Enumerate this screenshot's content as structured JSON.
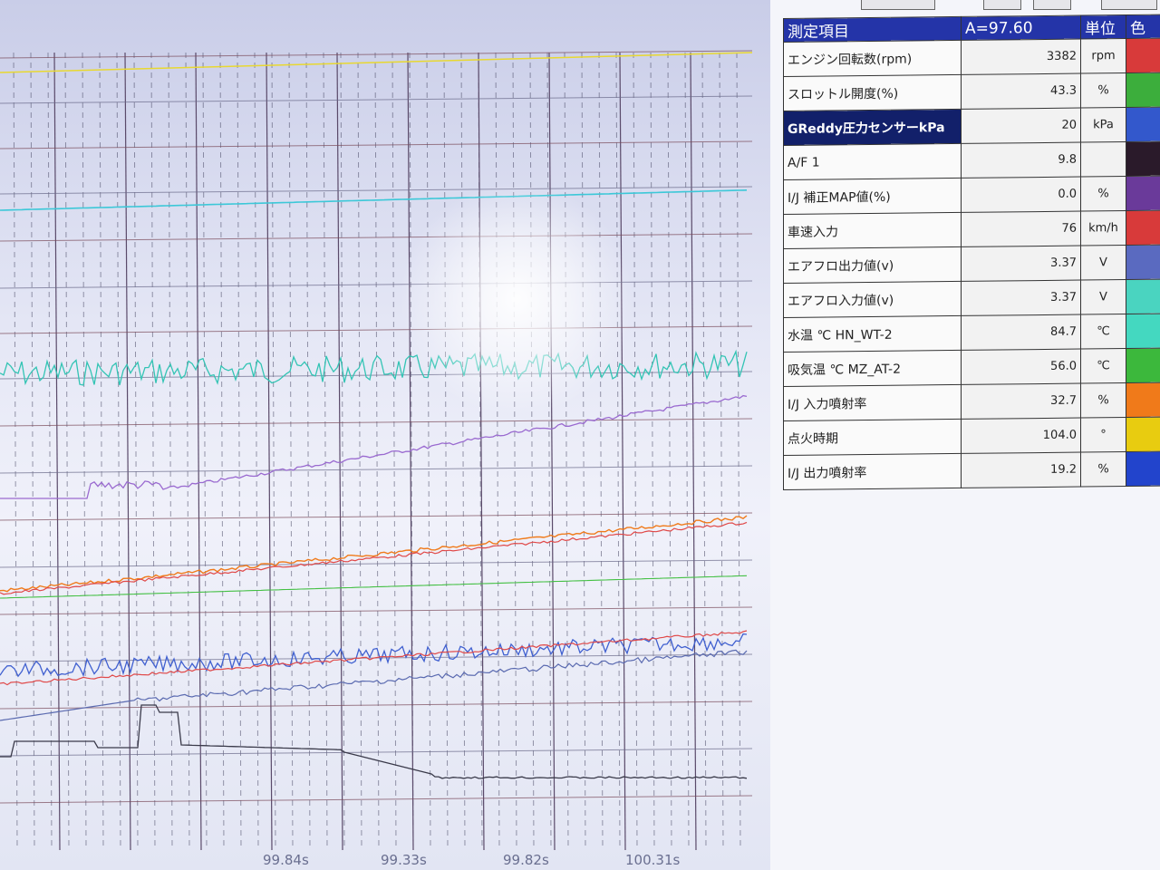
{
  "time_labels": [
    "99.84s",
    "99.33s",
    "99.82s",
    "100.31s"
  ],
  "table": {
    "headers": {
      "name": "測定項目",
      "value": "A=97.60",
      "unit": "単位",
      "color": "色"
    },
    "rows": [
      {
        "name": "エンジン回転数(rpm)",
        "value": "3382",
        "unit": "rpm",
        "color": "#d83a3a",
        "selected": false
      },
      {
        "name": "スロットル開度(%)",
        "value": "43.3",
        "unit": "%",
        "color": "#3cae3c",
        "selected": false
      },
      {
        "name": "GReddy圧力センサーkPa",
        "value": "20",
        "unit": "kPa",
        "color": "#3358cc",
        "selected": true
      },
      {
        "name": "A/F 1",
        "value": "9.8",
        "unit": "",
        "color": "#2a1a2a",
        "selected": false
      },
      {
        "name": "I/J 補正MAP値(%)",
        "value": "0.0",
        "unit": "%",
        "color": "#6a3a9a",
        "selected": false
      },
      {
        "name": "車速入力",
        "value": "76",
        "unit": "km/h",
        "color": "#d83a3a",
        "selected": false
      },
      {
        "name": "エアフロ出力値(v)",
        "value": "3.37",
        "unit": "V",
        "color": "#5a6ac0",
        "selected": false
      },
      {
        "name": "エアフロ入力値(v)",
        "value": "3.37",
        "unit": "V",
        "color": "#4ad4c0",
        "selected": false
      },
      {
        "name": "水温 ℃ HN_WT-2",
        "value": "84.7",
        "unit": "℃",
        "color": "#44d8c0",
        "selected": false
      },
      {
        "name": "吸気温 ℃ MZ_AT-2",
        "value": "56.0",
        "unit": "℃",
        "color": "#3cb83c",
        "selected": false
      },
      {
        "name": "I/J 入力噴射率",
        "value": "32.7",
        "unit": "%",
        "color": "#f07a1a",
        "selected": false
      },
      {
        "name": "点火時期",
        "value": "104.0",
        "unit": "°",
        "color": "#e8cc10",
        "selected": false
      },
      {
        "name": "I/J 出力噴射率",
        "value": "19.2",
        "unit": "%",
        "color": "#2244cc",
        "selected": false
      }
    ]
  },
  "trace_colors": {
    "cyan": "#3cc8d8",
    "teal": "#33c4b4",
    "purple": "#9a6ad0",
    "orange": "#f07a1a",
    "red": "#e04848",
    "green": "#44c044",
    "blue": "#4060d0",
    "slate": "#5a6ab0",
    "dark": "#3a3a4a"
  }
}
